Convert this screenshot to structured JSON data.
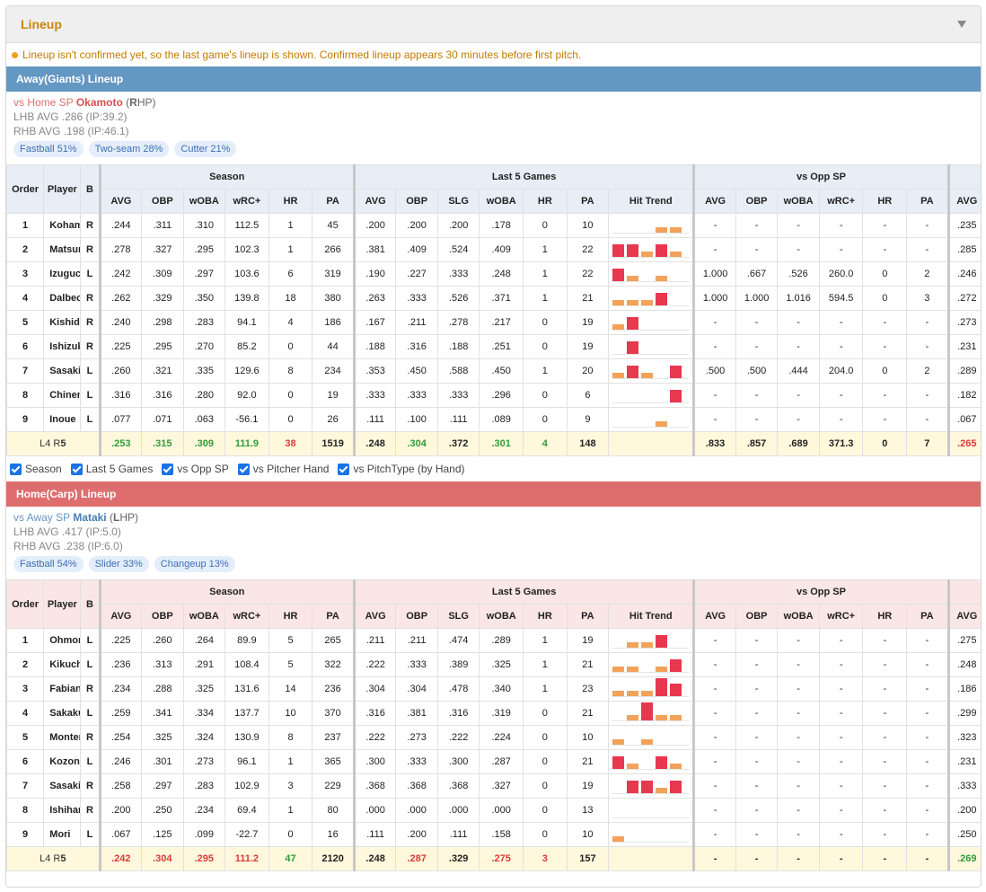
{
  "panel_title": "Lineup",
  "notice": "Lineup isn't confirmed yet, so the last game's lineup is shown. Confirmed lineup appears 30 minutes before first pitch.",
  "headers": {
    "order": "Order",
    "player": "Player",
    "bat": "B",
    "season": "Season",
    "last5": "Last 5 Games",
    "vsopp": "vs Opp SP",
    "cols": {
      "avg": "AVG",
      "obp": "OBP",
      "woba": "wOBA",
      "wrc": "wRC+",
      "hr": "HR",
      "pa": "PA",
      "slg": "SLG",
      "trend": "Hit Trend"
    }
  },
  "colors": {
    "bar_hit": "#e8384f",
    "bar_partial": "#f2a25a",
    "away": "#6497c2",
    "home": "#de6e6e",
    "checkbox": "#1a73e8"
  },
  "filters": [
    "Season",
    "Last 5 Games",
    "vs Opp SP",
    "vs Pitcher Hand",
    "vs PitchType (by Hand)"
  ],
  "away": {
    "bar_title": "Away(Giants) Lineup",
    "sp_prefix": "vs Home SP",
    "sp_name": "Okamoto",
    "sp_hand_open": "(",
    "sp_hand_letter": "R",
    "sp_hand_rest": "HP)",
    "lhb": "LHB AVG .286 (IP:39.2)",
    "rhb": "RHB AVG .198 (IP:46.1)",
    "pitches": [
      "Fastball 51%",
      "Two-seam 28%",
      "Cutter 21%"
    ],
    "rows": [
      {
        "order": "1",
        "player": "Kohama",
        "bat": "R",
        "s": [
          ".244",
          ".311",
          ".310",
          "112.5",
          "1",
          "45"
        ],
        "l": [
          ".200",
          ".200",
          ".200",
          ".178",
          "0",
          "10"
        ],
        "trend": [
          0,
          0,
          0,
          1,
          1
        ],
        "o": [
          "-",
          "-",
          "-",
          "-",
          "-",
          "-"
        ],
        "x": ".235"
      },
      {
        "order": "2",
        "player": "Matsumoto",
        "bat": "R",
        "s": [
          ".278",
          ".327",
          ".295",
          "102.3",
          "1",
          "266"
        ],
        "l": [
          ".381",
          ".409",
          ".524",
          ".409",
          "1",
          "22"
        ],
        "trend": [
          2,
          2,
          1,
          2,
          1
        ],
        "o": [
          "-",
          "-",
          "-",
          "-",
          "-",
          "-"
        ],
        "x": ".285"
      },
      {
        "order": "3",
        "player": "Izuguchi",
        "bat": "L",
        "s": [
          ".242",
          ".309",
          ".297",
          "103.6",
          "6",
          "319"
        ],
        "l": [
          ".190",
          ".227",
          ".333",
          ".248",
          "1",
          "22"
        ],
        "trend": [
          2,
          1,
          0,
          1,
          0
        ],
        "o": [
          "1.000",
          ".667",
          ".526",
          "260.0",
          "0",
          "2"
        ],
        "x": ".246"
      },
      {
        "order": "4",
        "player": "Dalbec",
        "bat": "R",
        "s": [
          ".262",
          ".329",
          ".350",
          "139.8",
          "18",
          "380"
        ],
        "l": [
          ".263",
          ".333",
          ".526",
          ".371",
          "1",
          "21"
        ],
        "trend": [
          1,
          1,
          1,
          2,
          0
        ],
        "o": [
          "1.000",
          "1.000",
          "1.016",
          "594.5",
          "0",
          "3"
        ],
        "x": ".272"
      },
      {
        "order": "5",
        "player": "Kishida",
        "bat": "R",
        "s": [
          ".240",
          ".298",
          ".283",
          "94.1",
          "4",
          "186"
        ],
        "l": [
          ".167",
          ".211",
          ".278",
          ".217",
          "0",
          "19"
        ],
        "trend": [
          1,
          2,
          0,
          0,
          0
        ],
        "o": [
          "-",
          "-",
          "-",
          "-",
          "-",
          "-"
        ],
        "x": ".273"
      },
      {
        "order": "6",
        "player": "Ishizuka",
        "bat": "R",
        "s": [
          ".225",
          ".295",
          ".270",
          "85.2",
          "0",
          "44"
        ],
        "l": [
          ".188",
          ".316",
          ".188",
          ".251",
          "0",
          "19"
        ],
        "trend": [
          0,
          2,
          0,
          0,
          0
        ],
        "o": [
          "-",
          "-",
          "-",
          "-",
          "-",
          "-"
        ],
        "x": ".231"
      },
      {
        "order": "7",
        "player": "Sasaki",
        "bat": "L",
        "s": [
          ".260",
          ".321",
          ".335",
          "129.6",
          "8",
          "234"
        ],
        "l": [
          ".353",
          ".450",
          ".588",
          ".450",
          "1",
          "20"
        ],
        "trend": [
          1,
          2,
          1,
          0,
          2
        ],
        "o": [
          ".500",
          ".500",
          ".444",
          "204.0",
          "0",
          "2"
        ],
        "x": ".289"
      },
      {
        "order": "8",
        "player": "Chinen",
        "bat": "L",
        "s": [
          ".316",
          ".316",
          ".280",
          "92.0",
          "0",
          "19"
        ],
        "l": [
          ".333",
          ".333",
          ".333",
          ".296",
          "0",
          "6"
        ],
        "trend": [
          0,
          0,
          0,
          0,
          2
        ],
        "o": [
          "-",
          "-",
          "-",
          "-",
          "-",
          "-"
        ],
        "x": ".182"
      },
      {
        "order": "9",
        "player": "Inoue",
        "bat": "L",
        "s": [
          ".077",
          ".071",
          ".063",
          "-56.1",
          "0",
          "26"
        ],
        "l": [
          ".111",
          ".100",
          ".111",
          ".089",
          "0",
          "9"
        ],
        "trend": [
          0,
          0,
          0,
          1,
          0
        ],
        "o": [
          "-",
          "-",
          "-",
          "-",
          "-",
          "-"
        ],
        "x": ".067"
      }
    ],
    "total": {
      "label_l": "L4",
      "label_r": "R",
      "label_rn": "5",
      "s": [
        ".253",
        ".315",
        ".309",
        "111.9",
        "38",
        "1519"
      ],
      "l": [
        ".248",
        ".304",
        ".372",
        ".301",
        "4",
        "148"
      ],
      "o": [
        ".833",
        ".857",
        ".689",
        "371.3",
        "0",
        "7"
      ],
      "x": ".265"
    }
  },
  "home": {
    "bar_title": "Home(Carp) Lineup",
    "sp_prefix": "vs Away SP",
    "sp_name": "Mataki",
    "sp_hand_open": "(",
    "sp_hand_letter": "L",
    "sp_hand_rest": "HP)",
    "lhb": "LHB AVG .417 (IP:5.0)",
    "rhb": "RHB AVG .238 (IP:6.0)",
    "pitches": [
      "Fastball 54%",
      "Slider 33%",
      "Changeup 13%"
    ],
    "rows": [
      {
        "order": "1",
        "player": "Ohmori",
        "bat": "L",
        "s": [
          ".225",
          ".260",
          ".264",
          "89.9",
          "5",
          "265"
        ],
        "l": [
          ".211",
          ".211",
          ".474",
          ".289",
          "1",
          "19"
        ],
        "trend": [
          0,
          1,
          1,
          2,
          0
        ],
        "o": [
          "-",
          "-",
          "-",
          "-",
          "-",
          "-"
        ],
        "x": ".275"
      },
      {
        "order": "2",
        "player": "Kikuchi",
        "bat": "L",
        "s": [
          ".236",
          ".313",
          ".291",
          "108.4",
          "5",
          "322"
        ],
        "l": [
          ".222",
          ".333",
          ".389",
          ".325",
          "1",
          "21"
        ],
        "trend": [
          1,
          1,
          0,
          1,
          2
        ],
        "o": [
          "-",
          "-",
          "-",
          "-",
          "-",
          "-"
        ],
        "x": ".248"
      },
      {
        "order": "3",
        "player": "Fabian",
        "bat": "R",
        "s": [
          ".234",
          ".288",
          ".325",
          "131.6",
          "14",
          "236"
        ],
        "l": [
          ".304",
          ".304",
          ".478",
          ".340",
          "1",
          "23"
        ],
        "trend": [
          1,
          1,
          1,
          3,
          2
        ],
        "o": [
          "-",
          "-",
          "-",
          "-",
          "-",
          "-"
        ],
        "x": ".186"
      },
      {
        "order": "4",
        "player": "Sakakura",
        "bat": "L",
        "s": [
          ".259",
          ".341",
          ".334",
          "137.7",
          "10",
          "370"
        ],
        "l": [
          ".316",
          ".381",
          ".316",
          ".319",
          "0",
          "21"
        ],
        "trend": [
          0,
          1,
          3,
          1,
          1
        ],
        "o": [
          "-",
          "-",
          "-",
          "-",
          "-",
          "-"
        ],
        "x": ".299"
      },
      {
        "order": "5",
        "player": "Montero",
        "bat": "R",
        "s": [
          ".254",
          ".325",
          ".324",
          "130.9",
          "8",
          "237"
        ],
        "l": [
          ".222",
          ".273",
          ".222",
          ".224",
          "0",
          "10"
        ],
        "trend": [
          1,
          0,
          1,
          0,
          0
        ],
        "o": [
          "-",
          "-",
          "-",
          "-",
          "-",
          "-"
        ],
        "x": ".323"
      },
      {
        "order": "6",
        "player": "Kozono",
        "bat": "L",
        "s": [
          ".246",
          ".301",
          ".273",
          "96.1",
          "1",
          "365"
        ],
        "l": [
          ".300",
          ".333",
          ".300",
          ".287",
          "0",
          "21"
        ],
        "trend": [
          2,
          1,
          0,
          2,
          1
        ],
        "o": [
          "-",
          "-",
          "-",
          "-",
          "-",
          "-"
        ],
        "x": ".231"
      },
      {
        "order": "7",
        "player": "Sasaki",
        "bat": "R",
        "s": [
          ".258",
          ".297",
          ".283",
          "102.9",
          "3",
          "229"
        ],
        "l": [
          ".368",
          ".368",
          ".368",
          ".327",
          "0",
          "19"
        ],
        "trend": [
          0,
          2,
          2,
          1,
          2
        ],
        "o": [
          "-",
          "-",
          "-",
          "-",
          "-",
          "-"
        ],
        "x": ".333"
      },
      {
        "order": "8",
        "player": "Ishihara",
        "bat": "R",
        "s": [
          ".200",
          ".250",
          ".234",
          "69.4",
          "1",
          "80"
        ],
        "l": [
          ".000",
          ".000",
          ".000",
          ".000",
          "0",
          "13"
        ],
        "trend": [
          0,
          0,
          0,
          0,
          0
        ],
        "o": [
          "-",
          "-",
          "-",
          "-",
          "-",
          "-"
        ],
        "x": ".200"
      },
      {
        "order": "9",
        "player": "Mori",
        "bat": "L",
        "s": [
          ".067",
          ".125",
          ".099",
          "-22.7",
          "0",
          "16"
        ],
        "l": [
          ".111",
          ".200",
          ".111",
          ".158",
          "0",
          "10"
        ],
        "trend": [
          1,
          0,
          0,
          0,
          0
        ],
        "o": [
          "-",
          "-",
          "-",
          "-",
          "-",
          "-"
        ],
        "x": ".250"
      }
    ],
    "total": {
      "label_l": "L4",
      "label_r": "R",
      "label_rn": "5",
      "s": [
        ".242",
        ".304",
        ".295",
        "111.2",
        "47",
        "2120"
      ],
      "l": [
        ".248",
        ".287",
        ".329",
        ".275",
        "3",
        "157"
      ],
      "o": [
        "-",
        "-",
        "-",
        "-",
        "-",
        "-"
      ],
      "x": ".269"
    }
  }
}
